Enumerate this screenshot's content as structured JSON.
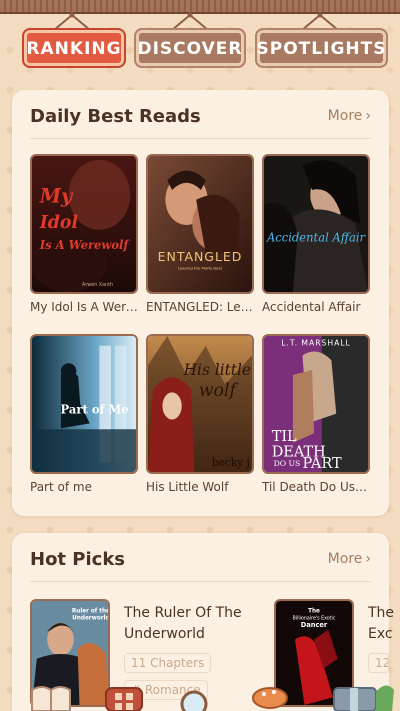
{
  "tabs": [
    {
      "label": "RANKING",
      "active": true
    },
    {
      "label": "DISCOVER",
      "active": false
    },
    {
      "label": "SPOTLIGHTS",
      "active": false
    }
  ],
  "daily": {
    "title": "Daily Best Reads",
    "more": "More",
    "books": [
      {
        "title": "My Idol Is A Werewolf",
        "cover_text": "My Idol Is A Werewolf",
        "author": "Arwen Xanth"
      },
      {
        "title": "ENTANGLED: Leaving the Mafia Boss",
        "cover_text": "ENTANGLED",
        "cover_sub": "Leaving the Mafia Boss"
      },
      {
        "title": "Accidental Affair",
        "cover_text": "Accidental Affair"
      },
      {
        "title": "Part of me",
        "cover_text": "Part of Me"
      },
      {
        "title": "His Little Wolf",
        "cover_text": "His little wolf",
        "author": "becky j"
      },
      {
        "title": "Til Death Do Us Part",
        "cover_text": "TIL DEATH DO US PART",
        "author": "L.T. MARSHALL"
      }
    ]
  },
  "hot": {
    "title": "Hot Picks",
    "more": "More",
    "items": [
      {
        "title": "The Ruler Of The Underworld",
        "chapters": "11 Chapters",
        "tag": "# Romance",
        "cover_text": "Ruler of the Underworld"
      },
      {
        "title": "The Billionaire's Exotic Dancer",
        "title_visible": "The Exc",
        "chip": "12",
        "cover_text": "The Billionaire's Exotic Dancer"
      }
    ]
  },
  "nav": [
    "book-icon",
    "grid-icon",
    "search-icon",
    "cake-icon",
    "gift-icon"
  ],
  "colors": {
    "accent": "#e25a3f",
    "tab": "#a97a62",
    "card": "#fbf0e2",
    "background": "#f3dcc0"
  }
}
